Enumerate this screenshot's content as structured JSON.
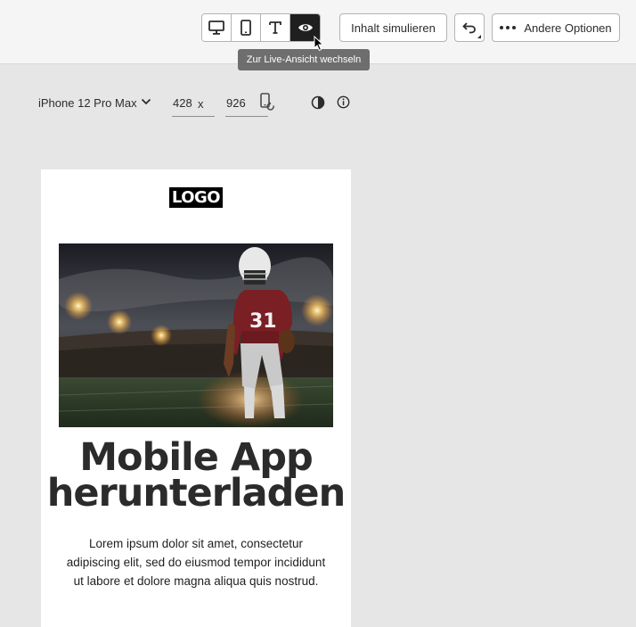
{
  "toolbar": {
    "view_buttons": [
      "desktop-icon",
      "mobile-icon",
      "text-icon",
      "eye-icon"
    ],
    "active_view": "eye-icon",
    "simulate_label": "Inhalt simulieren",
    "more_label": "Andere Optionen",
    "tooltip": "Zur Live-Ansicht wechseln"
  },
  "device": {
    "name": "iPhone 12 Pro Max",
    "width": "428",
    "x": "x",
    "height": "926"
  },
  "email": {
    "logo": "LOGO",
    "headline_line1": "Mobile App",
    "headline_line2": "herunterladen",
    "body_line1": "Lorem ipsum dolor sit amet, consectetur",
    "body_line2": "adipiscing elit, sed do eiusmod tempor incididunt",
    "body_line3": "ut labore et dolore magna aliqua quis nostrud.",
    "player_number": "31"
  },
  "colors": {
    "active_button": "#1f1f1f",
    "tooltip_bg": "#6e6e6e",
    "canvas_bg": "#e6e6e6"
  }
}
